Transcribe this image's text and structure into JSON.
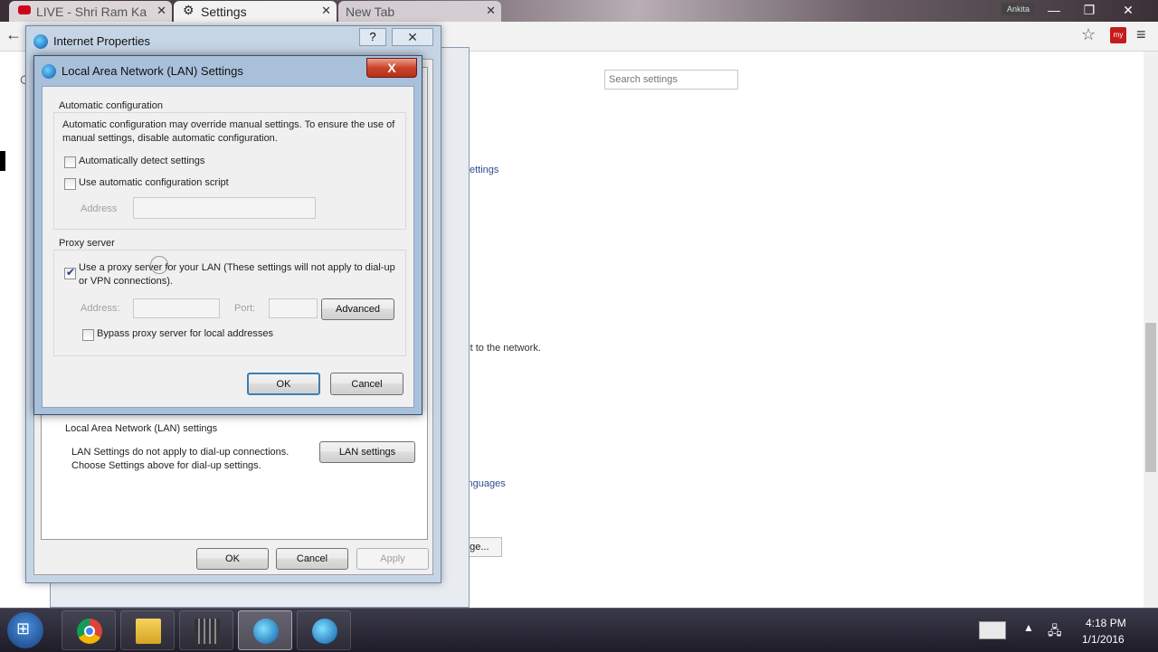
{
  "browser": {
    "tabs": [
      {
        "label": "LIVE - Shri Ram Ka",
        "icon": "youtube-icon"
      },
      {
        "label": "Settings",
        "icon": "gear-icon"
      },
      {
        "label": "New Tab",
        "icon": ""
      }
    ],
    "user_chip": "Ankita",
    "search_placeholder": "Search settings",
    "ext_badge": "my"
  },
  "settings_page": {
    "fragments": [
      "l settings",
      "ect to the network.",
      "languages",
      "nge..."
    ]
  },
  "internet_properties": {
    "title": "Internet Properties",
    "lan_group_label": "Local Area Network (LAN) settings",
    "lan_group_text": "LAN Settings do not apply to dial-up connections. Choose Settings above for dial-up settings.",
    "lan_settings_button": "LAN settings",
    "ok": "OK",
    "cancel": "Cancel",
    "apply": "Apply"
  },
  "lan_dialog": {
    "title": "Local Area Network (LAN) Settings",
    "close": "X",
    "auto_config": {
      "label": "Automatic configuration",
      "description": "Automatic configuration may override manual settings.  To ensure the use of manual settings, disable automatic configuration.",
      "auto_detect": {
        "label": "Automatically detect settings",
        "checked": false
      },
      "use_script": {
        "label": "Use automatic configuration script",
        "checked": false
      },
      "address_label": "Address",
      "address_value": ""
    },
    "proxy": {
      "label": "Proxy server",
      "use_proxy": {
        "label": "Use a proxy server for your LAN (These settings will not apply to dial-up or VPN connections).",
        "checked": true
      },
      "address_label": "Address:",
      "address_value": "",
      "port_label": "Port:",
      "port_value": "",
      "advanced": "Advanced",
      "bypass": {
        "label": "Bypass proxy server for local addresses",
        "checked": false
      }
    },
    "ok": "OK",
    "cancel": "Cancel"
  },
  "taskbar": {
    "time": "4:18 PM",
    "date": "1/1/2016"
  }
}
